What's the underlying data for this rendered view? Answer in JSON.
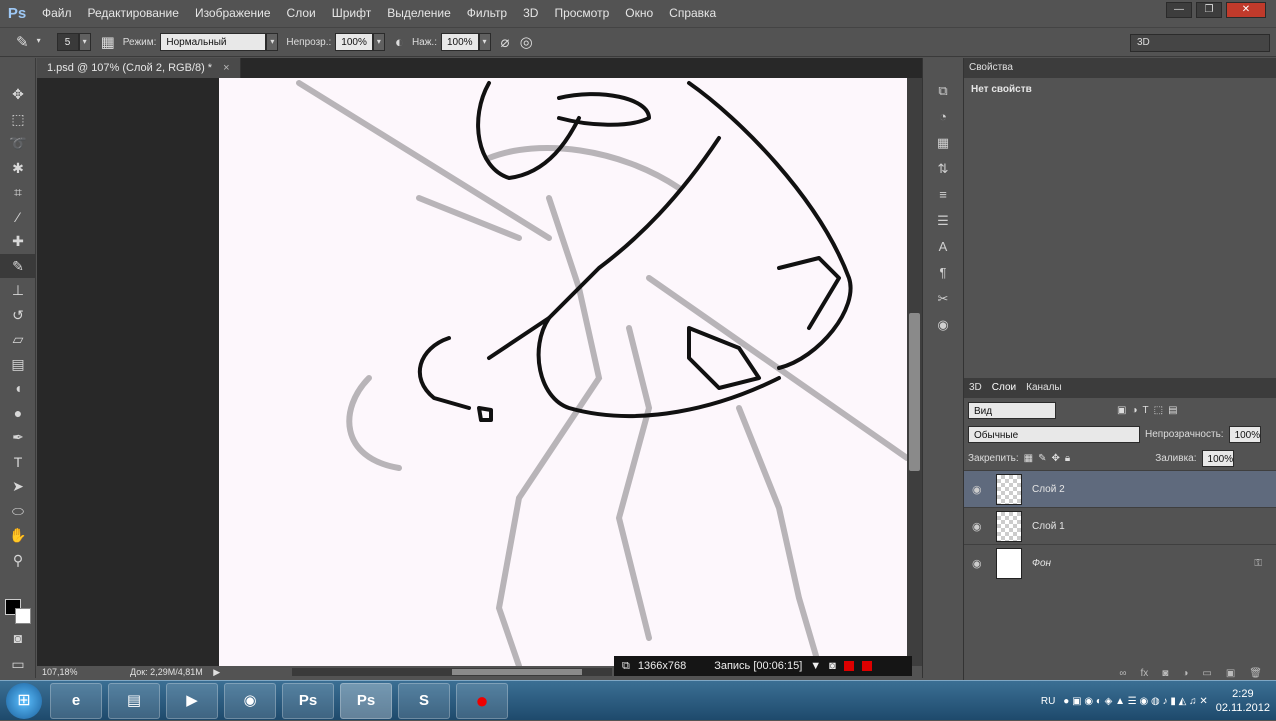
{
  "menu": {
    "logo": "Ps",
    "items": [
      "Файл",
      "Редактирование",
      "Изображение",
      "Слои",
      "Шрифт",
      "Выделение",
      "Фильтр",
      "3D",
      "Просмотр",
      "Окно",
      "Справка"
    ]
  },
  "window_controls": {
    "minimize": "—",
    "restore": "❐",
    "close": "✕"
  },
  "options": {
    "brush_size": "5",
    "mode_label": "Режим:",
    "mode_value": "Нормальный",
    "opacity_label": "Непрозр.:",
    "opacity_value": "100%",
    "pressure_label": "Наж.:",
    "pressure_value": "100%",
    "workspace": "3D"
  },
  "document": {
    "tab_title": "1.psd @ 107% (Слой 2, RGB/8) *",
    "zoom": "107,18%",
    "doc_size": "Док: 2,29M/4,81M"
  },
  "recorder": {
    "resolution": "1366x768",
    "status": "Запись [00:06:15]"
  },
  "properties": {
    "tab_label": "Свойства",
    "empty_text": "Нет свойств"
  },
  "layers_panel": {
    "tabs": [
      "3D",
      "Слои",
      "Каналы"
    ],
    "filter_label": "Вид",
    "blend_mode": "Обычные",
    "opacity_label": "Непрозрачность:",
    "opacity_value": "100%",
    "lock_label": "Закрепить:",
    "fill_label": "Заливка:",
    "fill_value": "100%",
    "layers": [
      {
        "name": "Слой 2"
      },
      {
        "name": "Слой 1"
      },
      {
        "name": "Фон"
      }
    ]
  },
  "taskbar": {
    "language": "RU",
    "time": "2:29",
    "date": "02.11.2012"
  },
  "colors": {
    "accent": "#5f6a7d",
    "foreground": "#000000",
    "background": "#ffffff"
  }
}
